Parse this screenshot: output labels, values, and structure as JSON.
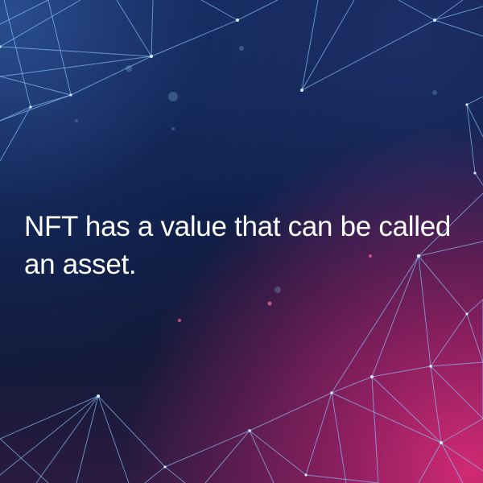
{
  "headline": "NFT has a value that can be called an asset.",
  "colors": {
    "background_top": "#0f2150",
    "background_bottom_glow": "#d12a73",
    "network_lines": "#8fc6ff",
    "text": "#ffffff"
  }
}
